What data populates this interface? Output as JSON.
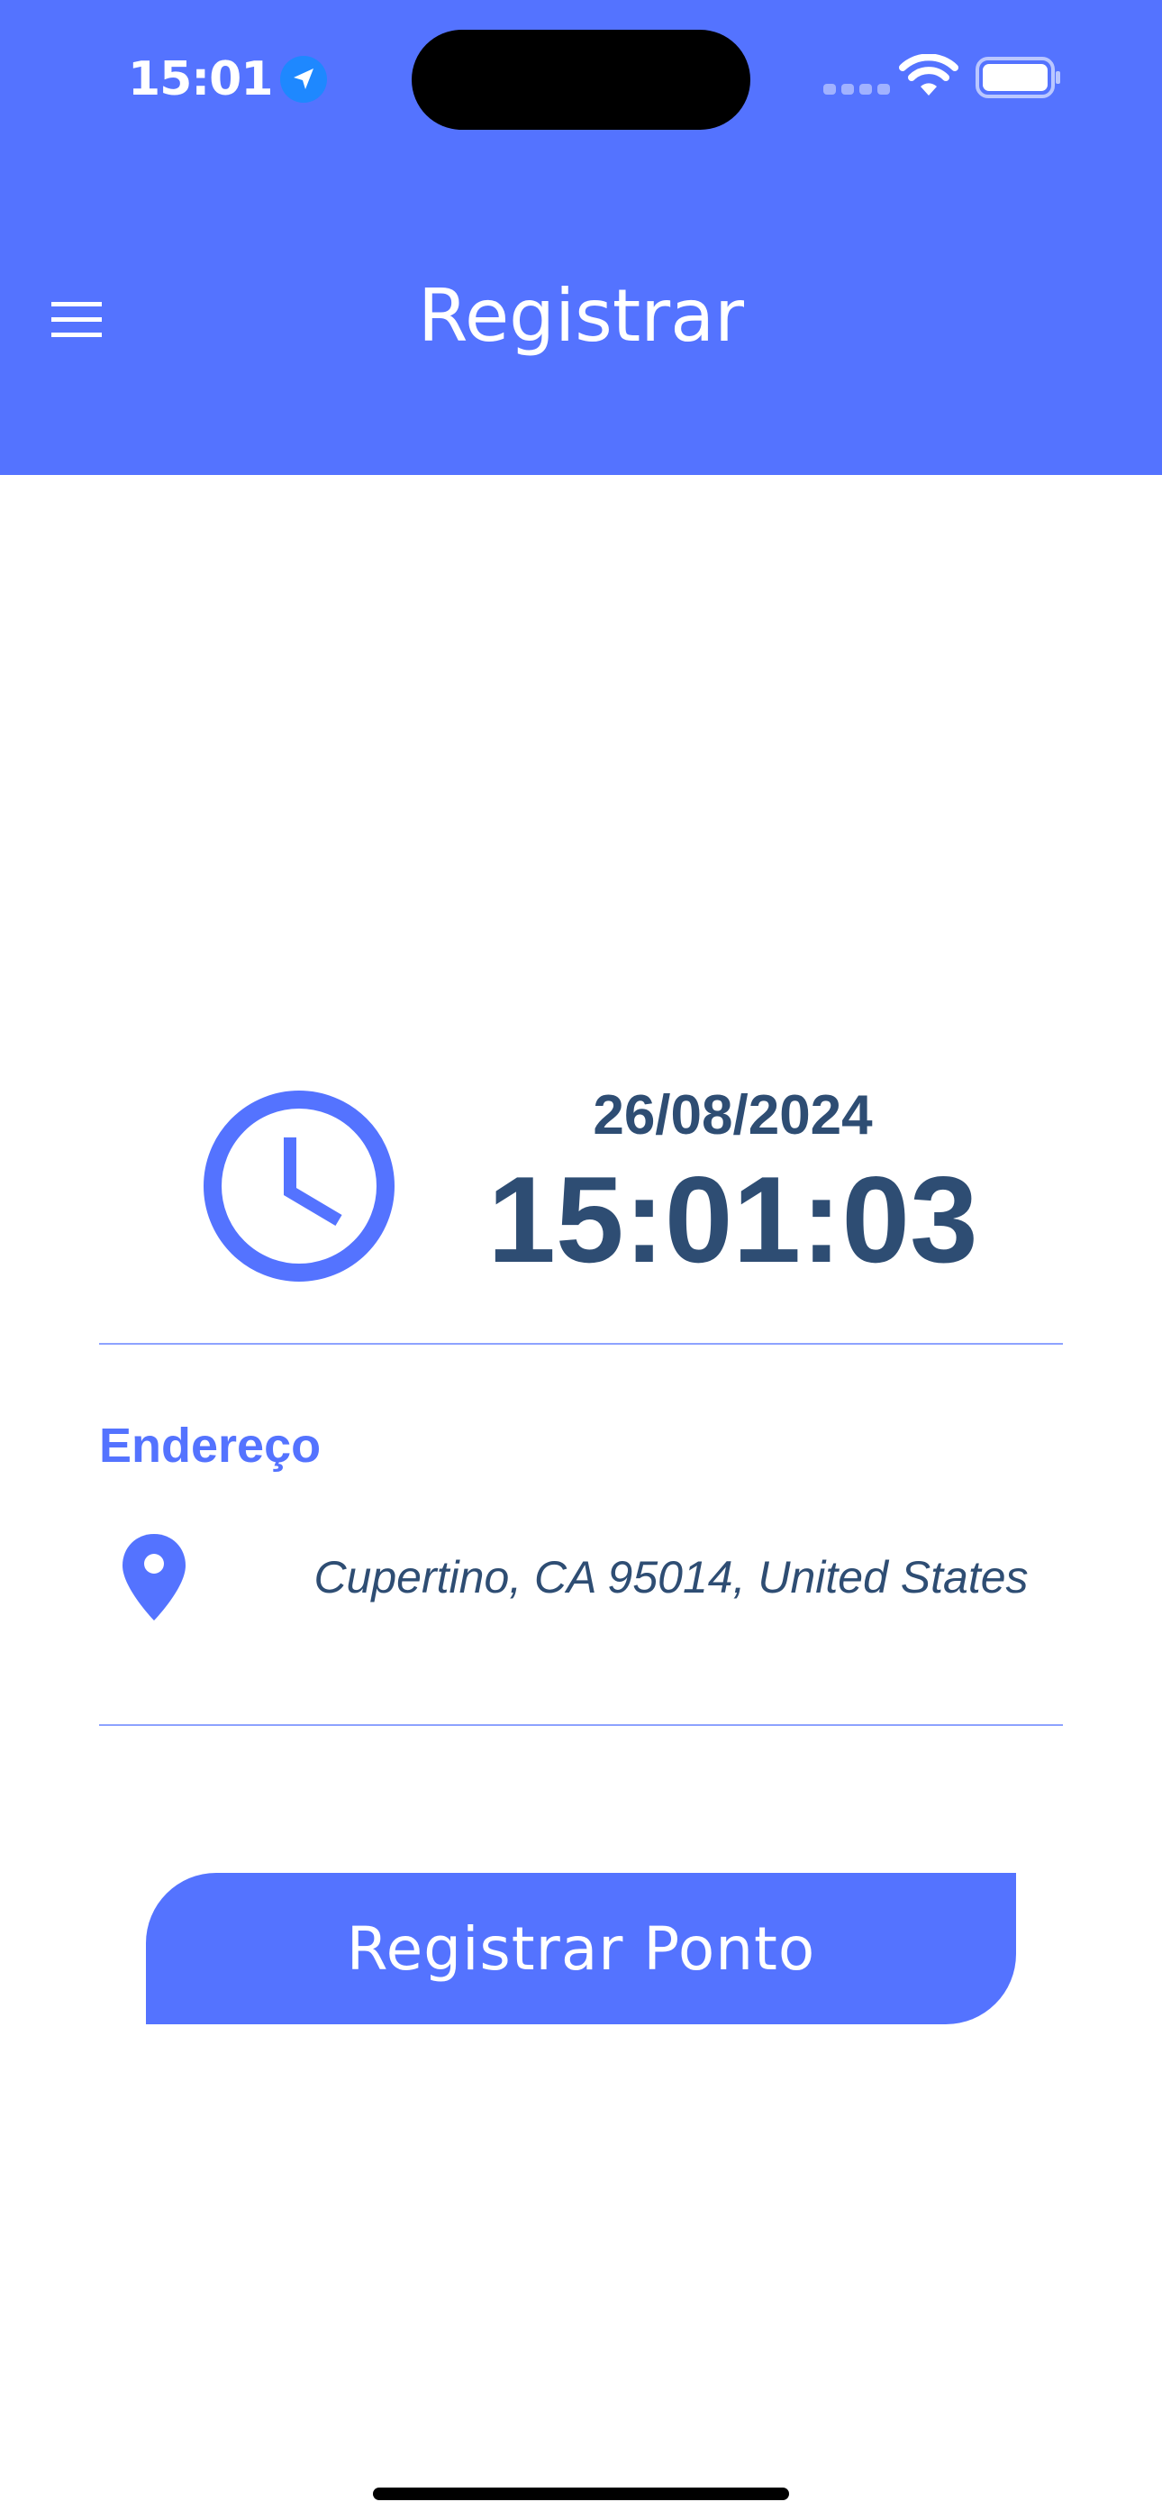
{
  "status_bar": {
    "time": "15:01",
    "location_icon": "location-arrow-icon",
    "wifi_icon": "wifi-icon",
    "battery_icon": "battery-icon",
    "signal_icon": "cellular-signal-icon"
  },
  "header": {
    "title": "Registrar",
    "menu_icon": "hamburger-menu-icon"
  },
  "clock": {
    "icon": "clock-icon",
    "date": "26/08/2024",
    "time": "15:01:03"
  },
  "address": {
    "label": "Endereço",
    "icon": "map-pin-icon",
    "value": "Cupertino, CA 95014, United States"
  },
  "actions": {
    "register_label": "Registrar Ponto"
  },
  "colors": {
    "primary": "#5473FF",
    "text_dark": "#2E4D73",
    "divider": "#8DA2FF",
    "background": "#FFFFFF"
  }
}
